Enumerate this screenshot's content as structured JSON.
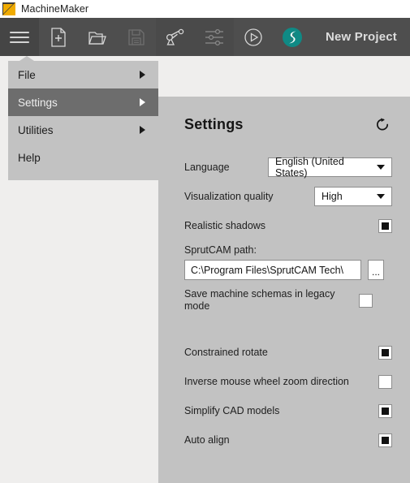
{
  "titlebar": {
    "app_name": "MachineMaker",
    "logo_icon": "machinemaker-logo-icon",
    "logo_color": "#f0ab00"
  },
  "toolbar": {
    "background": "#4e4e4e",
    "project_name": "New Project",
    "buttons": [
      {
        "name": "menu-button",
        "icon": "hamburger-icon",
        "label": ""
      },
      {
        "name": "new-file-button",
        "icon": "new-document-icon",
        "label": ""
      },
      {
        "name": "open-folder-button",
        "icon": "open-folder-icon",
        "label": ""
      },
      {
        "name": "save-button",
        "icon": "floppy-save-icon",
        "label": ""
      },
      {
        "name": "robot-button",
        "icon": "robot-arm-icon",
        "label": ""
      },
      {
        "name": "parameters-button",
        "icon": "sliders-icon",
        "label": ""
      },
      {
        "name": "play-button",
        "icon": "play-circle-icon",
        "label": ""
      },
      {
        "name": "sprutcam-button",
        "icon": "sprutcam-logo-icon",
        "label": ""
      }
    ]
  },
  "menu": {
    "items": [
      {
        "label": "File",
        "has_submenu": true,
        "selected": false
      },
      {
        "label": "Settings",
        "has_submenu": true,
        "selected": true
      },
      {
        "label": "Utilities",
        "has_submenu": true,
        "selected": false
      },
      {
        "label": "Help",
        "has_submenu": false,
        "selected": false
      }
    ]
  },
  "settings": {
    "title": "Settings",
    "reset_icon": "reset-circular-arrow-icon",
    "language": {
      "label": "Language",
      "value": "English (United States)"
    },
    "visualization_quality": {
      "label": "Visualization quality",
      "value": "High"
    },
    "realistic_shadows": {
      "label": "Realistic shadows",
      "checked": true
    },
    "sprutcam_path": {
      "label": "SprutCAM path:",
      "value": "C:\\Program Files\\SprutCAM Tech\\",
      "browse_label": "..."
    },
    "legacy_mode": {
      "label": "Save machine schemas in legacy mode",
      "checked": false
    },
    "constrained_rotate": {
      "label": "Constrained rotate",
      "checked": true
    },
    "inverse_zoom": {
      "label": "Inverse mouse wheel zoom direction",
      "checked": false
    },
    "simplify_cad": {
      "label": "Simplify CAD models",
      "checked": true
    },
    "auto_align": {
      "label": "Auto align",
      "checked": true
    }
  }
}
